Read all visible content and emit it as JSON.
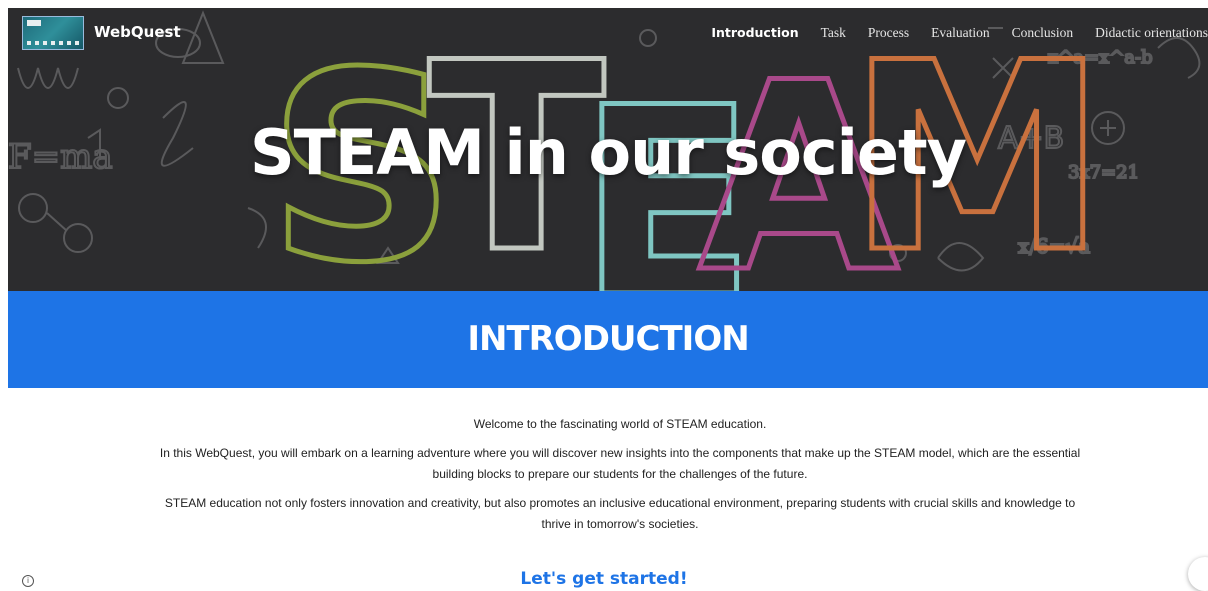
{
  "nav": {
    "brand": "WebQuest",
    "logo_icon": "webquest-logo",
    "items": [
      {
        "label": "Introduction",
        "active": true
      },
      {
        "label": "Task"
      },
      {
        "label": "Process"
      },
      {
        "label": "Evaluation"
      },
      {
        "label": "Conclusion"
      },
      {
        "label": "Didactic orientations"
      }
    ]
  },
  "hero": {
    "title": "STEAM in our society",
    "background_word": "STEAM"
  },
  "intro": {
    "heading": "INTRODUCTION",
    "paragraphs": [
      "Welcome to the fascinating world of STEAM education.",
      "In this WebQuest, you will embark on a learning adventure where you will discover new insights into the components that make up the STEAM model, which are the essential building blocks to prepare our students for the challenges of the future.",
      "STEAM education not only fosters innovation and creativity, but also promotes an inclusive educational environment, preparing students with crucial skills and knowledge to thrive in tomorrow's societies."
    ],
    "cta": "Let's get started!"
  },
  "colors": {
    "accent": "#1e74e6",
    "hero_bg": "#2c2c2e"
  }
}
